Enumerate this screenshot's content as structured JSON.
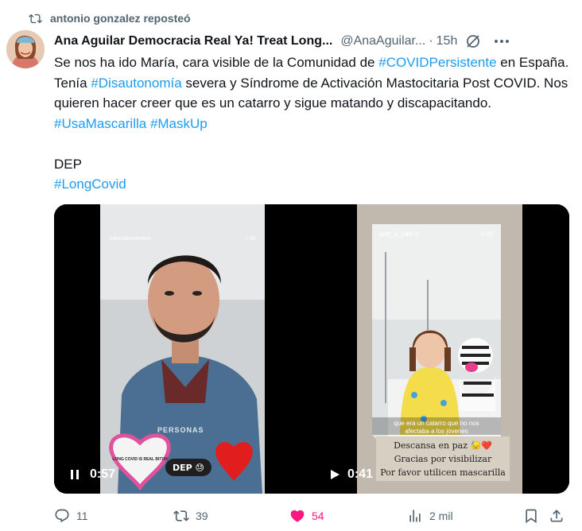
{
  "repost": {
    "label": "antonio gonzalez reposteó",
    "icon": "repost-icon"
  },
  "author": {
    "name": "Ana Aguilar Democracia Real Ya! Treat Long...",
    "handle": "@AnaAguilar...",
    "separator": "·",
    "time": "15h"
  },
  "post": {
    "p1_part1": "Se nos ha ido María, cara visible de la Comunidad de ",
    "p1_tag1": "#COVIDPersistente",
    "p1_part2": " en España. Tenía ",
    "p1_tag2": "#Disautonomía",
    "p1_part3": " severa y Síndrome de Activación Mastocitaria Post COVID. Nos quieren hacer creer que es un catarro y sigue matando y discapacitando. ",
    "p1_tag3": "#UsaMascarilla",
    "p1_space": " ",
    "p1_tag4": "#MaskUp",
    "p2": "DEP",
    "p3_tag": "#LongCovid"
  },
  "videos": [
    {
      "account": "tuinsolitocerebro",
      "clip_time": "1:30",
      "banner": "PERSONAS",
      "sticker": "LONG COVID IS REAL BITCH",
      "caption": "DEP 😓",
      "duration": "0:57",
      "state": "playing"
    },
    {
      "account": "port_a_cath.y",
      "clip_time": "0:42",
      "subtitle_line1": "que era un catarro que no nos",
      "subtitle_line2": "afectaba a los jóvenes",
      "caption_line1": "Descansa en paz 😓❤️",
      "caption_line2": "Gracias por visibilizar",
      "caption_line3": "Por favor utilicen mascarilla",
      "duration": "0:41",
      "state": "paused"
    }
  ],
  "actions": {
    "replies": "11",
    "reposts": "39",
    "likes": "54",
    "views": "2 mil"
  },
  "colors": {
    "accent": "#1d9bf0",
    "like": "#f91880",
    "muted": "#536471",
    "text": "#0f1419"
  }
}
